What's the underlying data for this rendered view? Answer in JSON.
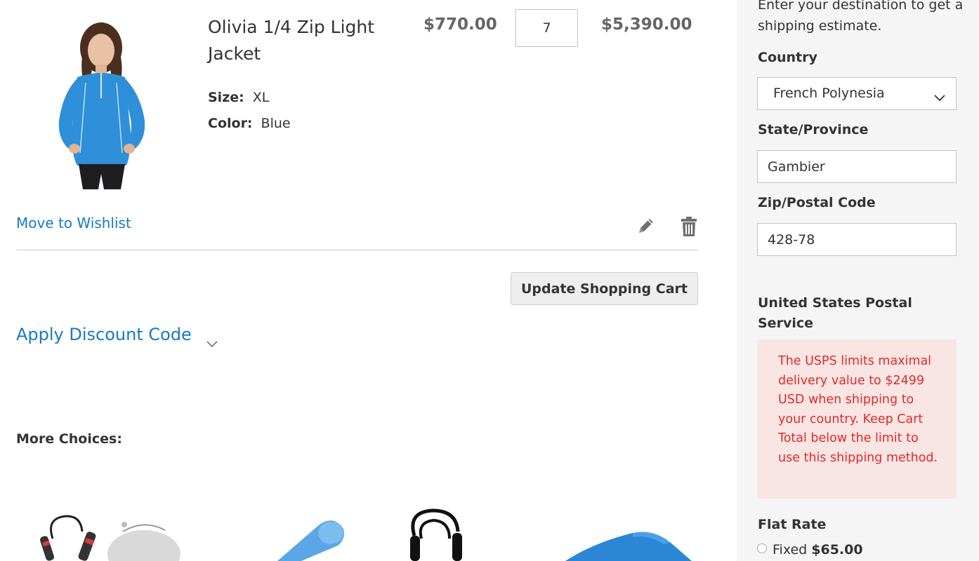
{
  "cart_item": {
    "name": "Olivia 1/4 Zip Light Jacket",
    "options": [
      {
        "label": "Size:",
        "value": "XL"
      },
      {
        "label": "Color:",
        "value": "Blue"
      }
    ],
    "price": "$770.00",
    "quantity": "7",
    "subtotal": "$5,390.00",
    "image_icon": "product-photo-woman-blue-jacket",
    "move_to_wishlist_label": "Move to Wishlist",
    "edit_icon": "pencil-icon",
    "delete_icon": "trash-icon"
  },
  "actions": {
    "update_cart_label": "Update Shopping Cart"
  },
  "discount": {
    "label": "Apply Discount Code",
    "icon": "chevron-down-icon"
  },
  "more_choices": {
    "heading": "More Choices:",
    "items": [
      {
        "icon": "jump-rope-icon"
      },
      {
        "icon": "foam-roller-icon"
      },
      {
        "icon": "resistance-band-icon"
      },
      {
        "icon": "yoga-mat-icon"
      }
    ]
  },
  "shipping_estimate": {
    "intro": "Enter your destination to get a shipping estimate.",
    "country_label": "Country",
    "country_value": "French Polynesia",
    "state_label": "State/Province",
    "state_value": "Gambier",
    "zip_label": "Zip/Postal Code",
    "zip_value": "428-78",
    "carrier_title": "United States Postal Service",
    "error_message": "The USPS limits maximal delivery value to $2499 USD when shipping to your country. Keep Cart Total below the limit to use this shipping method.",
    "flat_rate_title": "Flat Rate",
    "flat_rate_option_label": "Fixed",
    "flat_rate_option_price": "$65.00"
  },
  "colors": {
    "link": "#1979c3",
    "error_text": "#e02b27",
    "error_bg": "#fae5e5",
    "sidebar_bg": "#f5f5f5",
    "button_bg": "#eeeeee"
  }
}
